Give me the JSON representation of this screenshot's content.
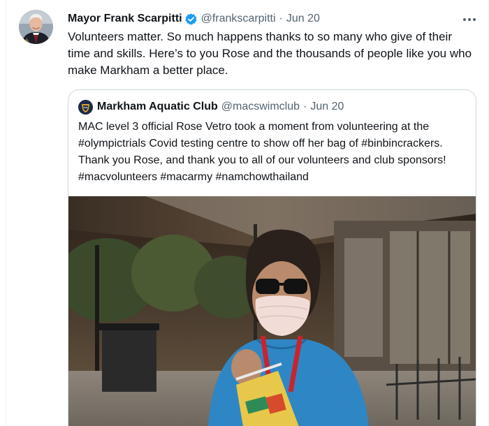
{
  "tweet": {
    "author": {
      "display_name": "Mayor Frank Scarpitti",
      "handle": "@frankscarpitti",
      "verified": true
    },
    "separator": "·",
    "date": "Jun 20",
    "more_icon": "more-horizontal-icon",
    "text": "Volunteers matter. So much happens thanks to so many who give of their time and skills. Here’s to you Rose and the thousands of people like you who make Markham a better place.",
    "quoted_tweet": {
      "author": {
        "display_name": "Markham Aquatic Club",
        "handle": "@macswimclub"
      },
      "separator": "·",
      "date": "Jun 20",
      "text": "MAC level 3 official Rose Vetro took a moment  from volunteering at the #olympictrials  Covid testing centre to show off her bag of #binbincrackers. Thank you Rose, and thank you to all of our volunteers and club sponsors! #macvolunteers #macarmy #namchowthailand",
      "media": "photo"
    }
  },
  "colors": {
    "text_primary": "#0f1419",
    "text_secondary": "#536471",
    "border": "#cfd9de",
    "verified_blue": "#1d9bf0"
  }
}
